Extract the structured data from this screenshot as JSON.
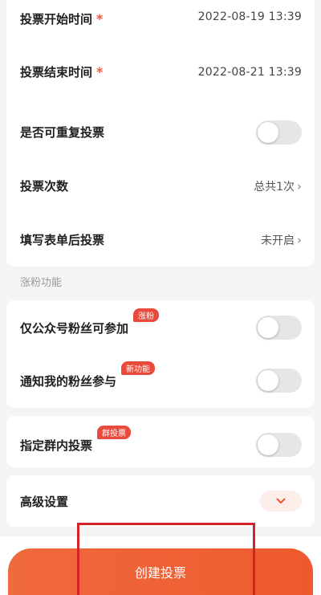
{
  "basic": {
    "start_time": {
      "label": "投票开始时间",
      "required": "*",
      "value": "2022-08-19 13:39"
    },
    "end_time": {
      "label": "投票结束时间",
      "required": "*",
      "value": "2022-08-21 13:39"
    },
    "repeat_vote": {
      "label": "是否可重复投票",
      "enabled": false
    },
    "vote_count": {
      "label": "投票次数",
      "value": "总共1次",
      "chevron": "›"
    },
    "form_vote": {
      "label": "填写表单后投票",
      "value": "未开启",
      "chevron": "›"
    }
  },
  "fans_section": {
    "title": "涨粉功能",
    "fans_only": {
      "label": "仅公众号粉丝可参加",
      "badge": "涨粉",
      "enabled": false
    },
    "notify_fans": {
      "label": "通知我的粉丝参与",
      "badge": "新功能",
      "enabled": false
    }
  },
  "group_vote": {
    "label": "指定群内投票",
    "badge": "群投票",
    "enabled": false
  },
  "advanced": {
    "label": "高级设置",
    "icon": "chevron-down-icon"
  },
  "primary_action": {
    "label": "创建投票"
  },
  "colors": {
    "accent": "#ee5a2e",
    "badge": "#e84a3b",
    "highlight": "#d3232a"
  }
}
